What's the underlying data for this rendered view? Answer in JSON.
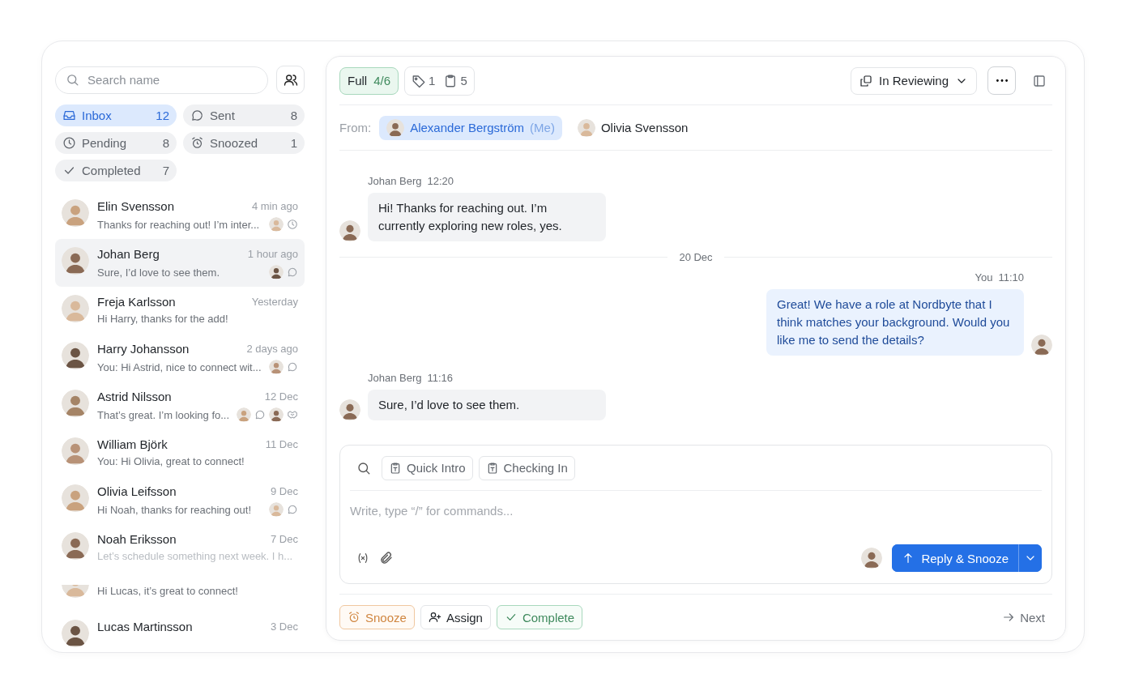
{
  "sidebar": {
    "search": {
      "placeholder": "Search name"
    },
    "folders": [
      {
        "label": "Inbox",
        "count": "12",
        "kind": "inbox",
        "selected": true
      },
      {
        "label": "Sent",
        "count": "8",
        "kind": "sent",
        "selected": false
      },
      {
        "label": "Pending",
        "count": "8",
        "kind": "pending",
        "selected": false
      },
      {
        "label": "Snoozed",
        "count": "1",
        "kind": "snoozed",
        "selected": false
      },
      {
        "label": "Completed",
        "count": "7",
        "kind": "completed",
        "selected": false
      }
    ],
    "conversations": [
      {
        "kind": "full",
        "name": "Elin Svensson",
        "time": "4 min ago",
        "preview": "Thanks for reaching out! I’m inter...",
        "selected": false,
        "activity": [
          {
            "kind": "pending"
          }
        ]
      },
      {
        "kind": "full",
        "name": "Johan Berg",
        "time": "1 hour ago",
        "preview": "Sure, I’d love to see them.",
        "selected": true,
        "activity": [
          {
            "kind": "replied"
          }
        ]
      },
      {
        "kind": "full",
        "name": "Freja Karlsson",
        "time": "Yesterday",
        "preview": "Hi Harry, thanks for the add!",
        "selected": false
      },
      {
        "kind": "full",
        "name": "Harry Johansson",
        "time": "2 days ago",
        "preview": "You: Hi Astrid, nice to connect wit...",
        "selected": false,
        "activity": [
          {
            "kind": "replied"
          }
        ]
      },
      {
        "kind": "full",
        "name": "Astrid Nilsson",
        "time": "12 Dec",
        "preview": "That’s great. I’m looking fo...",
        "selected": false,
        "activity": [
          {
            "kind": "replied"
          },
          {
            "kind": "deal"
          }
        ]
      },
      {
        "kind": "full",
        "name": "William Björk",
        "time": "11 Dec",
        "preview": "You: Hi Olivia, great to connect!",
        "selected": false
      },
      {
        "kind": "full",
        "name": "Olivia Leifsson",
        "time": "9 Dec",
        "preview": "Hi Noah, thanks for reaching out!",
        "selected": false,
        "activity": [
          {
            "kind": "replied"
          }
        ]
      },
      {
        "kind": "full",
        "name": "Noah Eriksson",
        "time": "7 Dec",
        "preview": "Let’s schedule something next week. I h...",
        "selected": false,
        "dimmed": true
      },
      {
        "kind": "partial",
        "preview": "Hi Lucas, it’s great to connect!",
        "selected": false
      },
      {
        "kind": "head",
        "name": "Lucas Martinsson",
        "time": "3 Dec",
        "selected": false
      }
    ]
  },
  "header": {
    "plan": {
      "label": "Full",
      "count": "4/6"
    },
    "tags": "1",
    "notes": "5",
    "status": "In Reviewing"
  },
  "from": {
    "label": "From:",
    "senders": [
      {
        "name": "Alexander Bergström",
        "suffix": "(Me)",
        "selected": true
      },
      {
        "name": "Olivia Svensson",
        "selected": false
      }
    ]
  },
  "messages": [
    {
      "kind": "incoming",
      "sender": "Johan Berg",
      "time": "12:20",
      "text": "Hi! Thanks for reaching out. I’m currently exploring new roles, yes."
    },
    {
      "kind": "date",
      "text": "20 Dec"
    },
    {
      "kind": "outgoing",
      "sender": "You",
      "time": "11:10",
      "text": "Great! We have a role at Nordbyte that I think matches your background. Would you like me to send the details?"
    },
    {
      "kind": "incoming",
      "sender": "Johan Berg",
      "time": "11:16",
      "text": "Sure, I’d love to see them."
    }
  ],
  "composer": {
    "templates": [
      "Quick Intro",
      "Checking In"
    ],
    "placeholder": "Write, type “/” for commands...",
    "send": "Reply & Snooze"
  },
  "actions": [
    {
      "kind": "snooze",
      "label": "Snooze"
    },
    {
      "kind": "assign",
      "label": "Assign"
    },
    {
      "kind": "complete",
      "label": "Complete"
    },
    {
      "kind": "next",
      "label": "Next"
    }
  ]
}
